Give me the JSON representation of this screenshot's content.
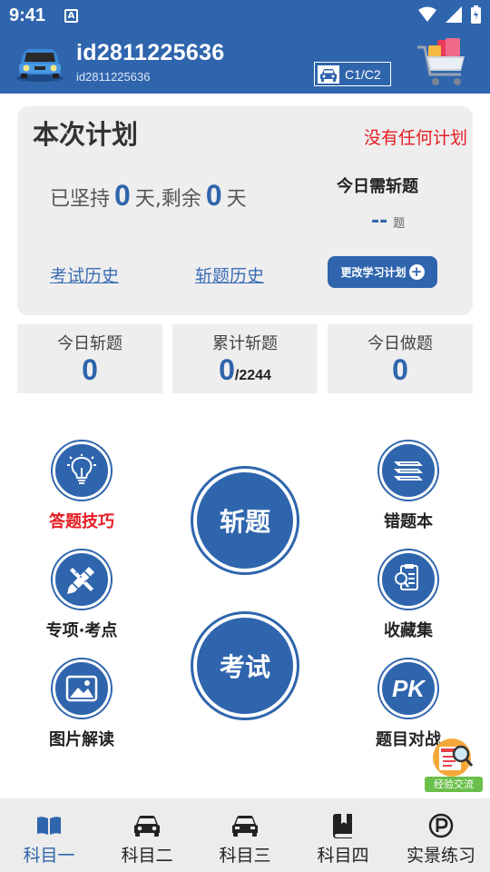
{
  "status_bar": {
    "time": "9:41",
    "notification_icon": "A"
  },
  "header": {
    "username": "id2811225636",
    "user_id": "id2811225636",
    "license_type": "C1/C2"
  },
  "plan": {
    "title": "本次计划",
    "no_plan_text": "没有任何计划",
    "persist_prefix": "已坚持",
    "persist_days": "0",
    "persist_mid": "天,剩余",
    "remaining_days": "0",
    "persist_suffix": "天",
    "today_need_label": "今日需斩题",
    "today_need_value": "--",
    "today_need_unit": "题",
    "exam_history": "考试历史",
    "cut_history": "斩题历史",
    "change_plan": "更改学习计划"
  },
  "stats": [
    {
      "label": "今日斩题",
      "value": "0",
      "suffix": ""
    },
    {
      "label": "累计斩题",
      "value": "0",
      "suffix": "/2244"
    },
    {
      "label": "今日做题",
      "value": "0",
      "suffix": ""
    }
  ],
  "features": {
    "tips": "答题技巧",
    "special": "专项·考点",
    "images": "图片解读",
    "wrong_book": "错题本",
    "favorites": "收藏集",
    "pk": "题目对战",
    "cut_questions": "斩题",
    "exam": "考试",
    "pk_icon_text": "PK"
  },
  "exp_badge": "经验交流",
  "colors": {
    "primary": "#2f65ad",
    "red": "#e51c23",
    "badge_green": "#6bbf4a"
  },
  "bottom_nav": [
    {
      "label": "科目一",
      "icon": "book-icon",
      "active": true
    },
    {
      "label": "科目二",
      "icon": "car-icon",
      "active": false
    },
    {
      "label": "科目三",
      "icon": "car-front-icon",
      "active": false
    },
    {
      "label": "科目四",
      "icon": "bookmark-book-icon",
      "active": false
    },
    {
      "label": "实景练习",
      "icon": "parking-icon",
      "active": false
    }
  ]
}
